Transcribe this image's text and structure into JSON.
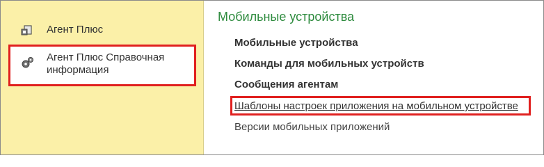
{
  "sidebar": {
    "items": [
      {
        "label": "Агент Плюс",
        "icon": "agent-plus-icon"
      },
      {
        "label_line1": "Агент Плюс Справочная",
        "label_line2": "информация",
        "icon": "info-gears-icon"
      }
    ]
  },
  "main": {
    "title": "Мобильные устройства",
    "links": [
      "Мобильные устройства",
      "Команды для мобильных устройств",
      "Сообщения агентам",
      "Шаблоны настроек приложения на мобильном устройстве",
      "Версии мобильных приложений"
    ]
  },
  "colors": {
    "sidebar_bg": "#fbf0a8",
    "title_green": "#2e8b3e",
    "highlight_red": "#e0201f"
  }
}
